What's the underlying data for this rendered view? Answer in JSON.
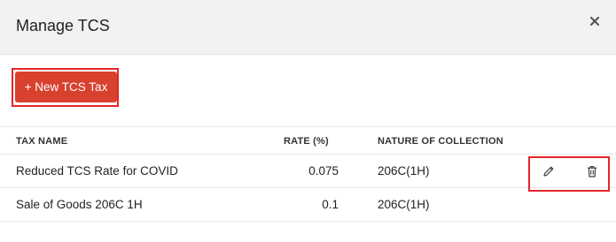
{
  "modal": {
    "title": "Manage TCS",
    "close_icon": "close-icon"
  },
  "toolbar": {
    "new_button_label": "+ New TCS Tax",
    "accent_color": "#d9412f",
    "highlight_color": "#e3262b"
  },
  "table": {
    "columns": [
      "TAX NAME",
      "RATE (%)",
      "NATURE OF COLLECTION"
    ],
    "rows": [
      {
        "name": "Reduced TCS Rate for COVID",
        "rate": "0.075",
        "nature": "206C(1H)"
      },
      {
        "name": "Sale of Goods 206C 1H",
        "rate": "0.1",
        "nature": "206C(1H)"
      }
    ],
    "row_actions": [
      "pencil-icon",
      "trash-icon"
    ]
  }
}
